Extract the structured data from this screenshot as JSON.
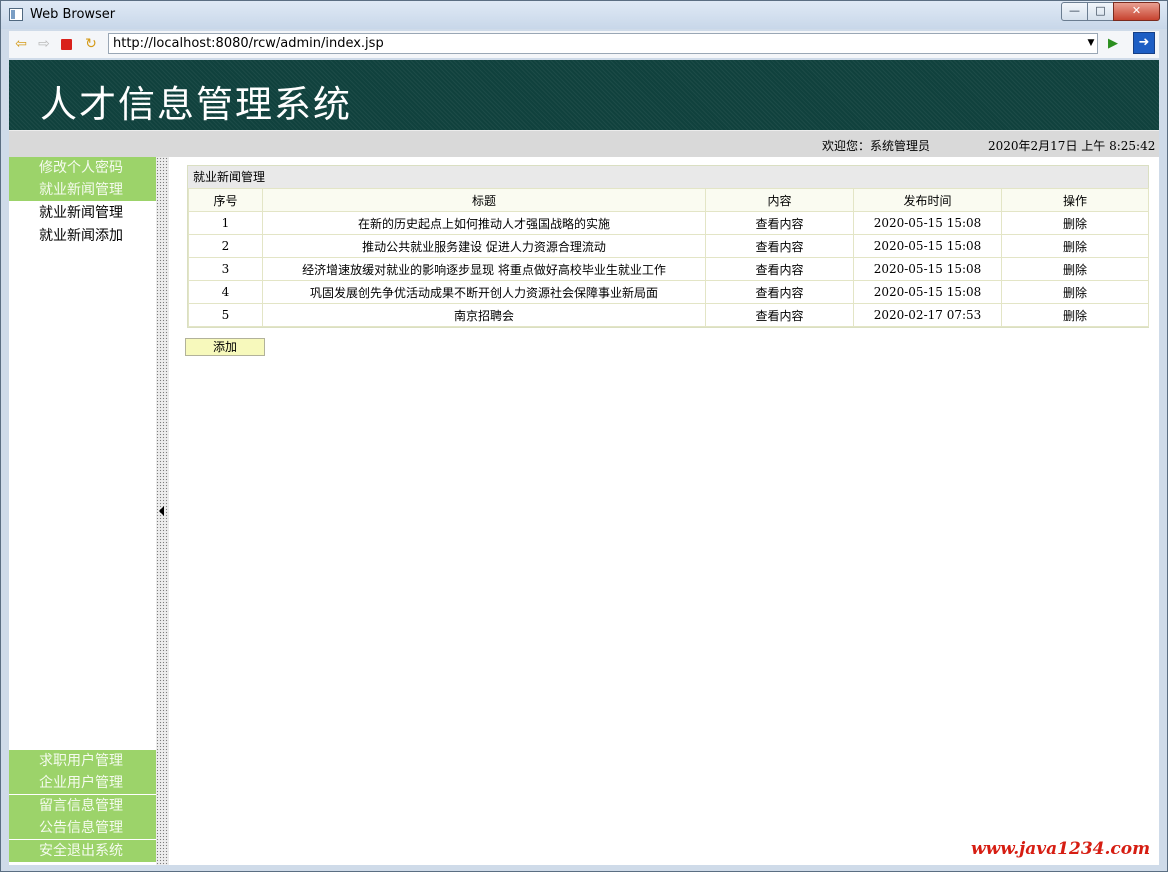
{
  "window": {
    "title": "Web Browser"
  },
  "toolbar": {
    "url": "http://localhost:8080/rcw/admin/index.jsp"
  },
  "header": {
    "title": "人才信息管理系统"
  },
  "status": {
    "welcome": "欢迎您：系统管理员",
    "datetime": "2020年2月17日 上午 8:25:42"
  },
  "sidebar": {
    "top_items": [
      {
        "label": "修改个人密码"
      },
      {
        "label": "就业新闻管理"
      },
      {
        "label": "就业新闻管理"
      },
      {
        "label": "就业新闻添加"
      }
    ],
    "bottom_items": [
      {
        "label": "求职用户管理"
      },
      {
        "label": "企业用户管理"
      },
      {
        "label": "留言信息管理"
      },
      {
        "label": "公告信息管理"
      },
      {
        "label": "安全退出系统"
      }
    ]
  },
  "panel": {
    "title": "就业新闻管理",
    "columns": [
      "序号",
      "标题",
      "内容",
      "发布时间",
      "操作"
    ],
    "rows": [
      {
        "no": "1",
        "title": "在新的历史起点上如何推动人才强国战略的实施",
        "content": "查看内容",
        "time": "2020-05-15 15:08",
        "action": "删除"
      },
      {
        "no": "2",
        "title": "推动公共就业服务建设 促进人力资源合理流动",
        "content": "查看内容",
        "time": "2020-05-15 15:08",
        "action": "删除"
      },
      {
        "no": "3",
        "title": "经济增速放缓对就业的影响逐步显现 将重点做好高校毕业生就业工作",
        "content": "查看内容",
        "time": "2020-05-15 15:08",
        "action": "删除"
      },
      {
        "no": "4",
        "title": "巩固发展创先争优活动成果不断开创人力资源社会保障事业新局面",
        "content": "查看内容",
        "time": "2020-05-15 15:08",
        "action": "删除"
      },
      {
        "no": "5",
        "title": "南京招聘会",
        "content": "查看内容",
        "time": "2020-02-17 07:53",
        "action": "删除"
      }
    ],
    "add_label": "添加"
  },
  "watermark": "www.java1234.com",
  "colors": {
    "header_bg": "#10413d",
    "menu_green": "#9cd36a",
    "add_button": "#f7f9bc",
    "watermark": "#d61d12"
  }
}
